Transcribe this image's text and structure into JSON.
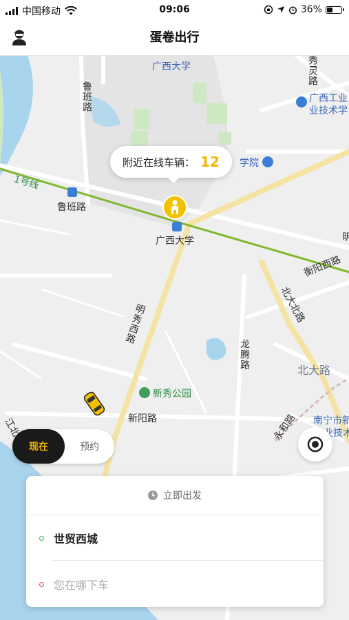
{
  "status_bar": {
    "carrier": "中国移动",
    "time": "09:06",
    "battery": "36%",
    "battery_level": 0.36
  },
  "nav": {
    "title": "蛋卷出行"
  },
  "map": {
    "labels": {
      "guangxi_univ_top": "广西大学",
      "luban_vertical": "鲁班路",
      "xiu_ling": "秀灵路",
      "gx_industry": "广西工业",
      "gx_industry_2": "业技术学",
      "xueyuan": "学院",
      "metro_line": "1号线",
      "luban_road": "鲁班路",
      "guangxi_univ": "广西大学",
      "mingxiu_west": "明秀西路",
      "hengyang_west": "衡阳西路",
      "beida_north": "北大北路",
      "longteng": "龙腾路",
      "beida": "北大路",
      "xinxiu_park": "新秀公园",
      "xinyang": "新阳路",
      "yonghe": "永和路",
      "nanning_city": "南宁市新",
      "nanning_city_2": "业技术",
      "jiang": "江北",
      "edge_d": "明"
    },
    "nearby_label": "附近在线车辆：",
    "nearby_count": "12"
  },
  "mode_toggle": {
    "now": "现在",
    "reserve": "预约"
  },
  "trip": {
    "depart": "立即出发",
    "origin": "世贸西城",
    "destination_placeholder": "您在哪下车"
  },
  "colors": {
    "accent": "#f2b700",
    "dark": "#1a1a1a",
    "metro": "#7fb82e",
    "water": "#a9d4ee",
    "park": "#cfe8c4"
  }
}
